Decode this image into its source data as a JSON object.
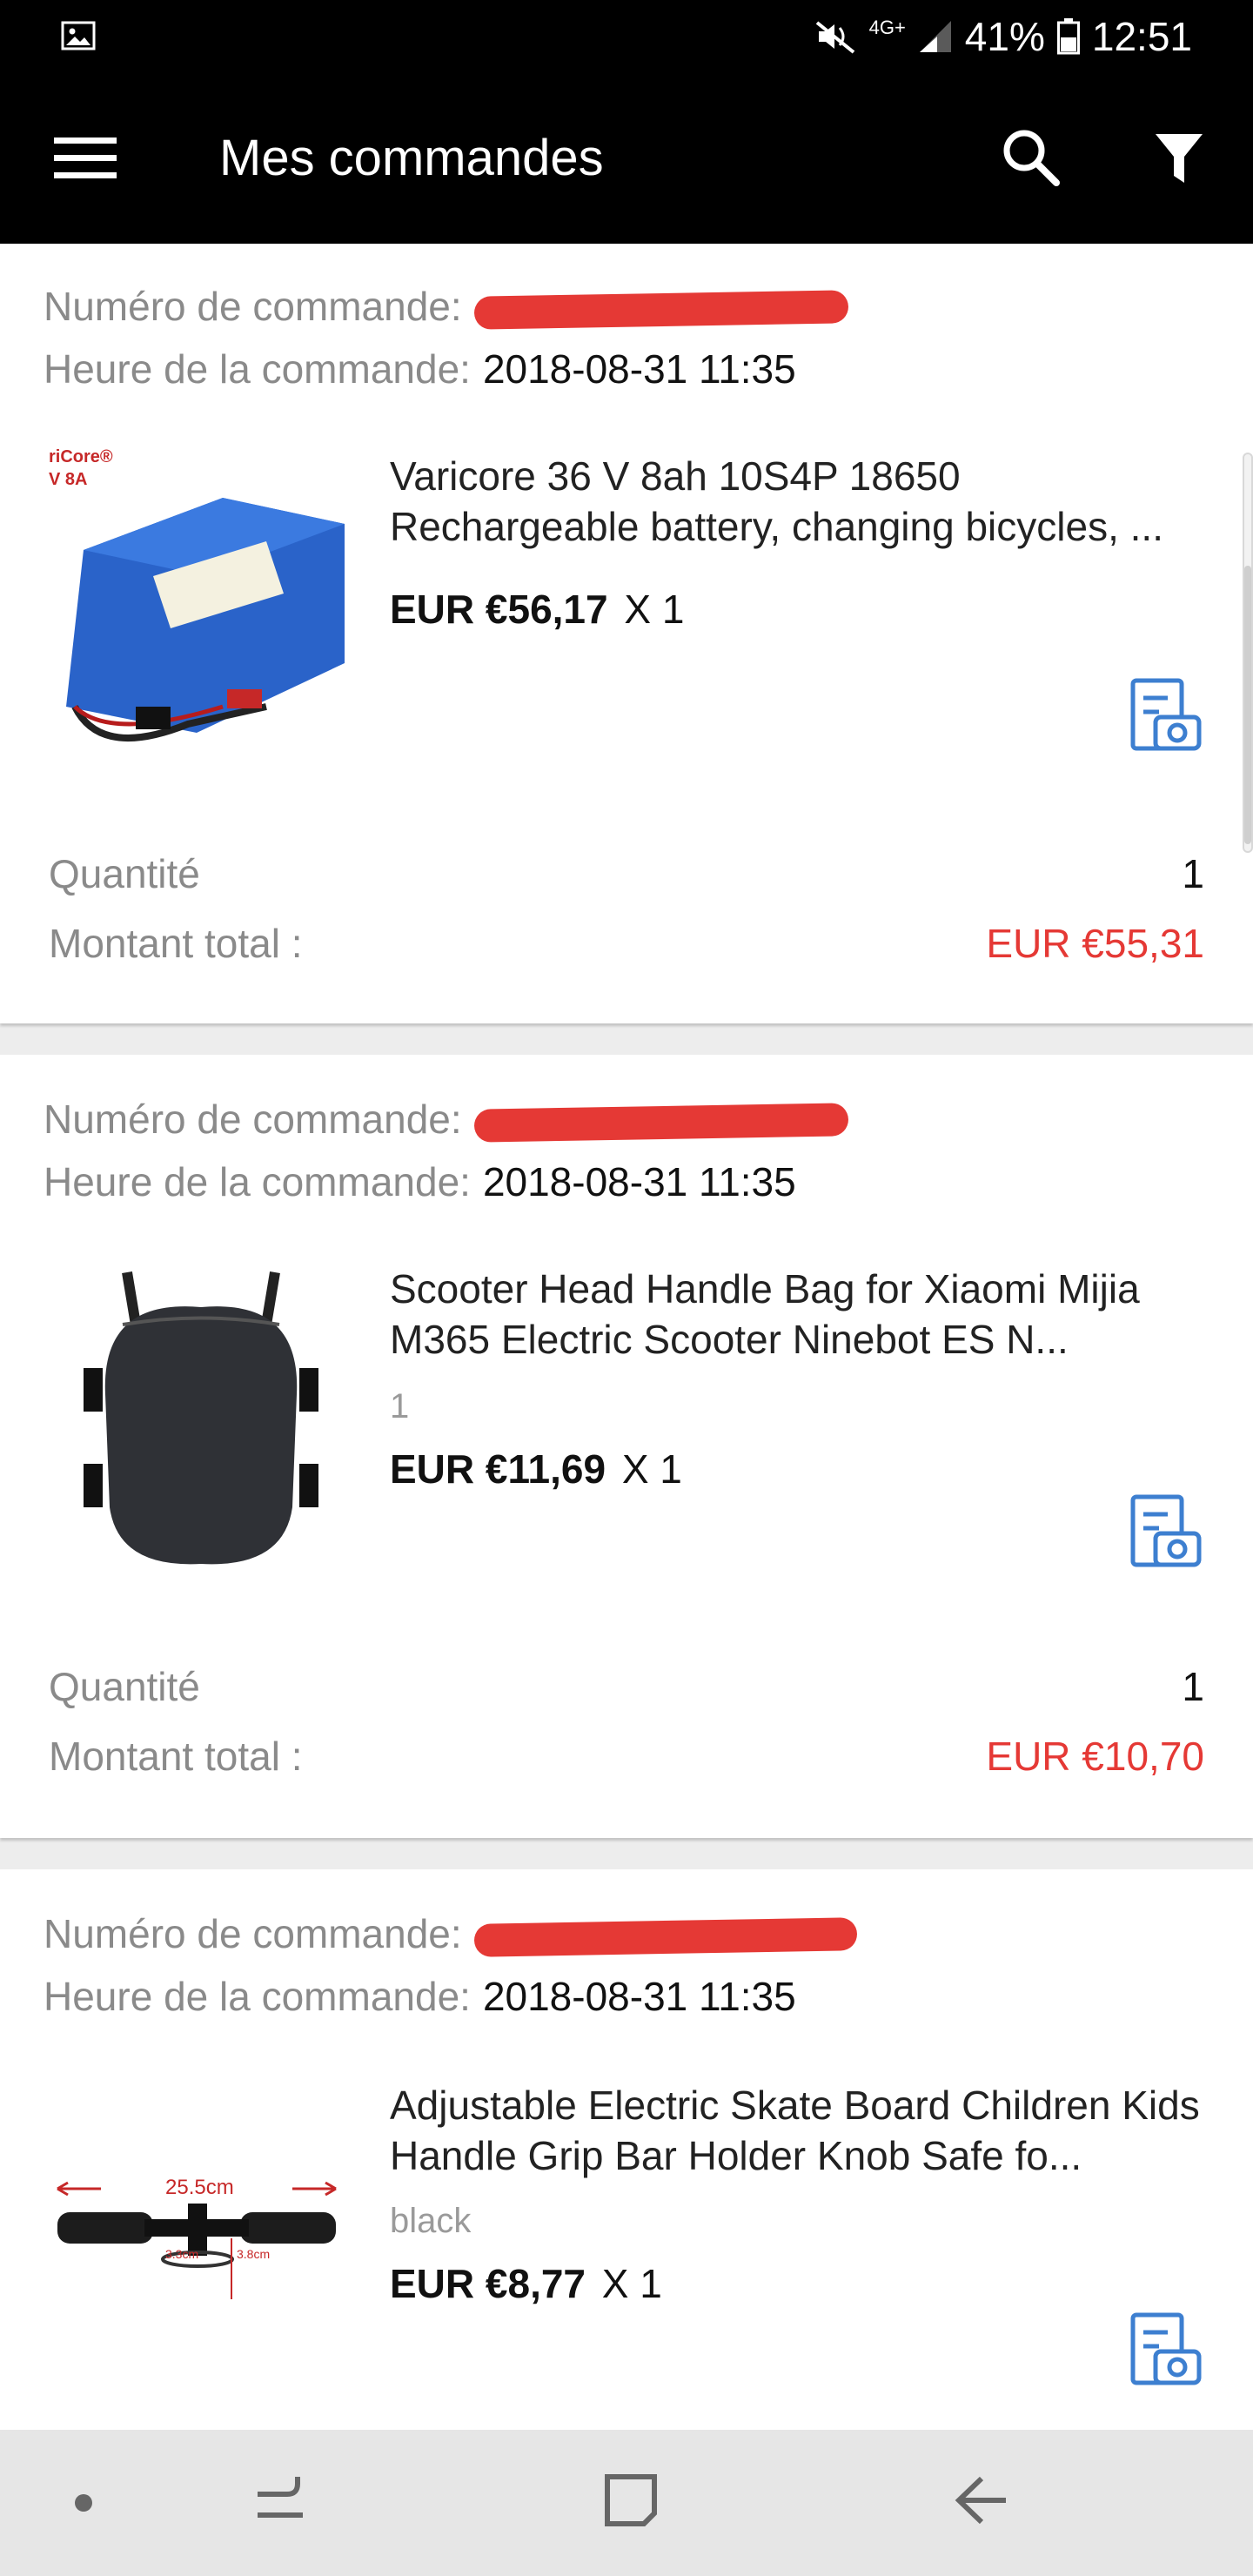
{
  "status_bar": {
    "network": "4G+",
    "battery": "41%",
    "time": "12:51"
  },
  "app_bar": {
    "title": "Mes commandes",
    "icons": [
      "menu-icon",
      "search-icon",
      "filter-icon"
    ]
  },
  "labels": {
    "order_number": "Numéro de commande:",
    "order_time": "Heure de la commande:",
    "quantity": "Quantité",
    "total": "Montant total :"
  },
  "orders": [
    {
      "order_time": "2018-08-31 11:35",
      "product_title": "Varicore 36 V 8ah 10S4P 18650 Rechargeable battery, changing bicycles, ...",
      "variant": "",
      "price": "EUR €56,17",
      "times": "X 1",
      "quantity": "1",
      "total": "EUR €55,31",
      "thumb_text": "riCore® / V 8A"
    },
    {
      "order_time": "2018-08-31 11:35",
      "product_title": "Scooter Head Handle Bag for Xiaomi Mijia M365 Electric Scooter Ninebot ES N...",
      "variant": "1",
      "price": "EUR €11,69",
      "times": "X 1",
      "quantity": "1",
      "total": "EUR €10,70"
    },
    {
      "order_time": "2018-08-31 11:35",
      "product_title": "Adjustable Electric Skate Board Children Kids Handle Grip Bar Holder Knob Safe fo...",
      "variant": "black",
      "price": "EUR €8,77",
      "times": "X 1",
      "thumb_text": "25.5cm",
      "thumb_dims": [
        "3.3cm",
        "3.8cm"
      ]
    }
  ],
  "colors": {
    "accent_red": "#e53935",
    "icon_blue": "#3d7fd0",
    "bar": "#000000"
  }
}
